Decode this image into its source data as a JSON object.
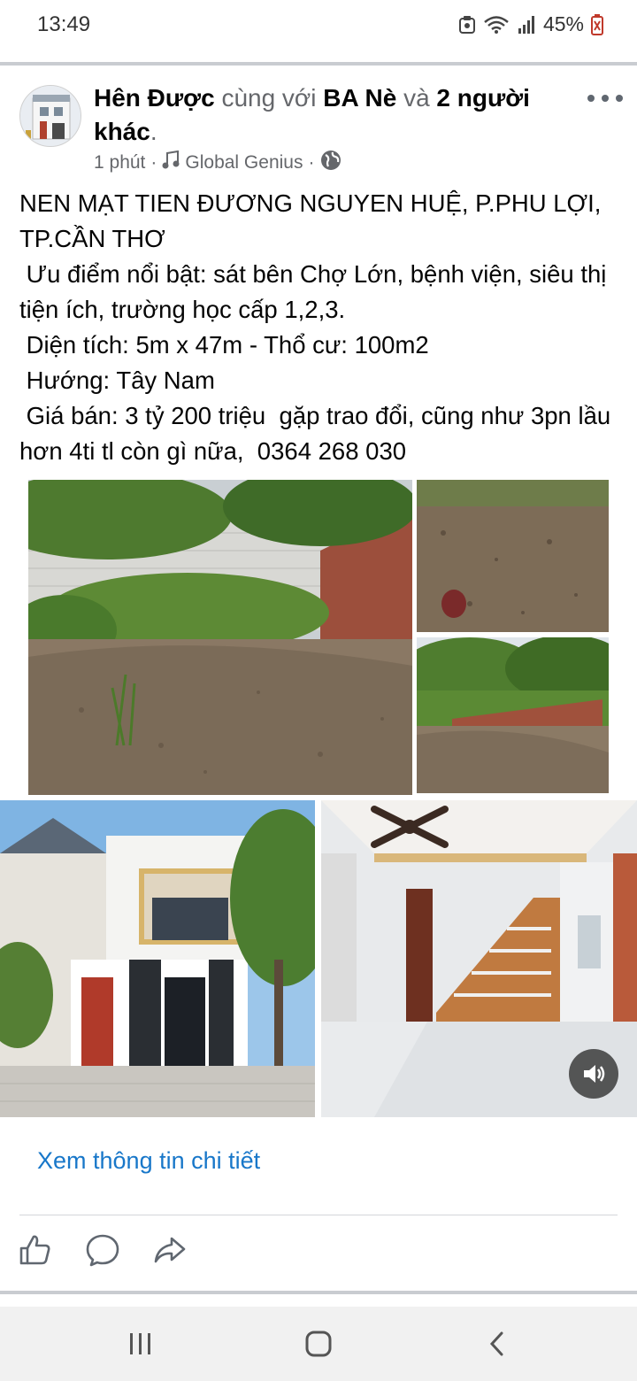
{
  "status": {
    "time": "13:49",
    "battery": "45%"
  },
  "post": {
    "author": "Hên Được",
    "with_text": "cùng với",
    "tagged": "BA Nè",
    "and_text": "và",
    "others": "2 người khác",
    "period": ".",
    "time": "1 phút",
    "sep": "·",
    "music": "Global Genius",
    "lines": [
      "NEN MẠT TIEN ĐƯƠNG NGUYEN HUỆ, P.PHU LỢI, TP.CẦN THƠ",
      " Ưu điểm nổi bật: sát bên Chợ Lớn, bệnh viện, siêu thị tiện ích, trường học cấp 1,2,3.",
      " Diện tích: 5m x 47m - Thổ cư: 100m2",
      " Hướng: Tây Nam",
      " Giá bán: 3 tỷ 200 triệu  gặp trao đổi, cũng như 3pn lầu hơn 4ti tl còn gì nữa,  0364 268 030"
    ],
    "see_more": "Xem thông tin chi tiết"
  },
  "icons": {
    "like": "like-icon",
    "comment": "comment-icon",
    "share": "share-icon",
    "sound": "sound-icon"
  },
  "colors": {
    "link": "#1877c9",
    "divider": "#c9ccd1"
  }
}
